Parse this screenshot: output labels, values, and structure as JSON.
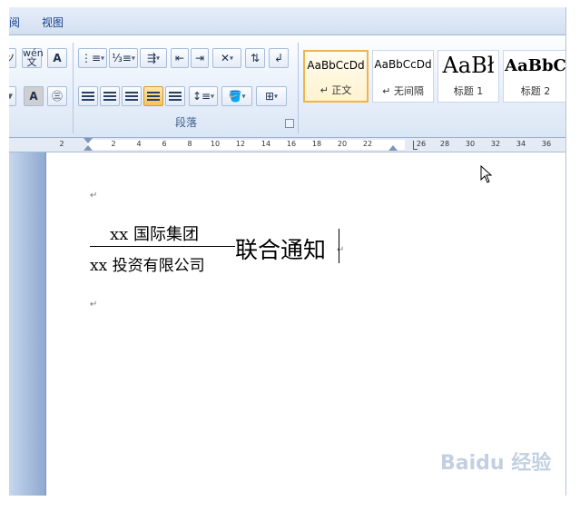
{
  "tabs": [
    "阅",
    "视图"
  ],
  "paragraph_group_label": "段落",
  "styles": [
    {
      "sample": "AaBbCcDd",
      "name": "↵ 正文"
    },
    {
      "sample": "AaBbCcDd",
      "name": "↵ 无间隔"
    },
    {
      "sample": "AaBł",
      "name": "标题 1"
    },
    {
      "sample": "AaBbC",
      "name": "标题 2"
    }
  ],
  "ruler_numbers": [
    "2",
    "2",
    "4",
    "6",
    "8",
    "10",
    "12",
    "14",
    "16",
    "18",
    "20",
    "22",
    "26",
    "28",
    "30",
    "32",
    "34",
    "36"
  ],
  "document": {
    "paragraph_mark": "↵",
    "company_top": "xx 国际集团",
    "company_bottom": "xx 投资有限公司",
    "title": "联合通知",
    "watermark": "Baidu 经验"
  }
}
